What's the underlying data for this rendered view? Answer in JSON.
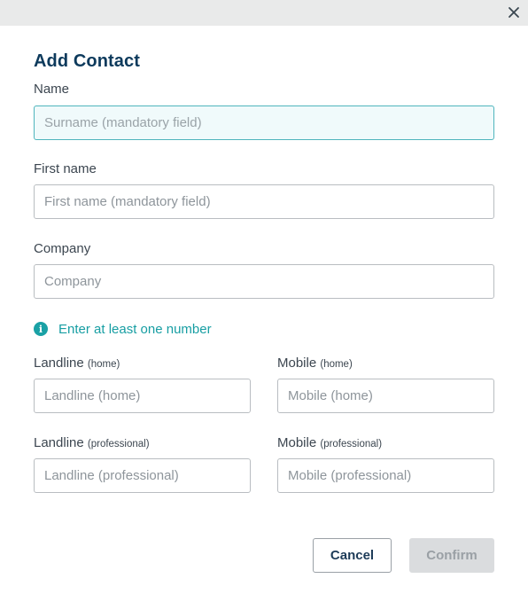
{
  "dialog": {
    "title": "Add Contact",
    "close_icon": "close-icon"
  },
  "fields": {
    "name": {
      "label": "Name",
      "placeholder": "Surname (mandatory field)",
      "value": ""
    },
    "first_name": {
      "label": "First name",
      "placeholder": "First name (mandatory field)",
      "value": ""
    },
    "company": {
      "label": "Company",
      "placeholder": "Company",
      "value": ""
    },
    "landline_home": {
      "label": "Landline",
      "sub": "(home)",
      "placeholder": "Landline (home)",
      "value": ""
    },
    "mobile_home": {
      "label": "Mobile",
      "sub": "(home)",
      "placeholder": "Mobile (home)",
      "value": ""
    },
    "landline_pro": {
      "label": "Landline",
      "sub": "(professional)",
      "placeholder": "Landline (professional)",
      "value": ""
    },
    "mobile_pro": {
      "label": "Mobile",
      "sub": "(professional)",
      "placeholder": "Mobile (professional)",
      "value": ""
    }
  },
  "info": {
    "icon": "info-icon",
    "text": "Enter at least one number"
  },
  "buttons": {
    "cancel": "Cancel",
    "confirm": "Confirm"
  },
  "colors": {
    "title": "#0d3a5c",
    "accent": "#1aa1a5",
    "focus_border": "#4fb5bd",
    "disabled_bg": "#dadcde"
  }
}
